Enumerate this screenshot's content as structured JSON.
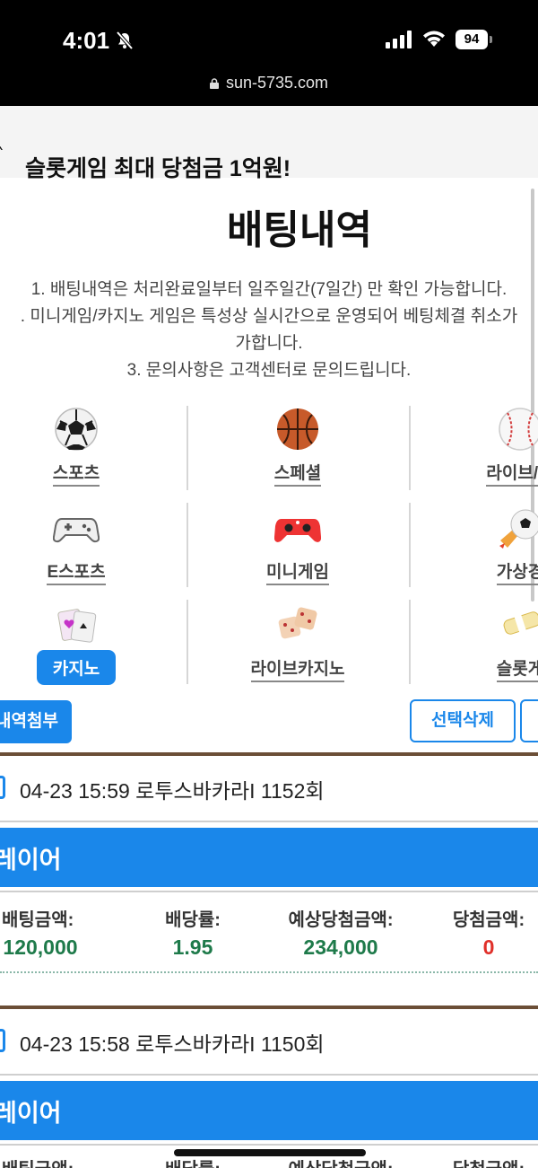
{
  "status": {
    "time": "4:01",
    "battery": "94",
    "url": "sun-5735.com"
  },
  "banner": {
    "text": "슬롯게임 최대 당첨금 1억원!"
  },
  "page": {
    "title": "배팅내역",
    "notice": [
      "1. 배팅내역은 처리완료일부터 일주일간(7일간) 만 확인 가능합니다.",
      ". 미니게임/카지노 게임은 특성상 실시간으로 운영되어 베팅체결 취소가",
      "가합니다.",
      "3. 문의사항은 고객센터로 문의드립니다."
    ]
  },
  "categories": [
    {
      "label": "스포츠",
      "icon": "soccer-ball-icon"
    },
    {
      "label": "스페셜",
      "icon": "basketball-icon"
    },
    {
      "label": "라이브/실",
      "icon": "baseball-icon"
    },
    {
      "label": "E스포츠",
      "icon": "gamepad-icon"
    },
    {
      "label": "미니게임",
      "icon": "red-controller-icon"
    },
    {
      "label": "가상경",
      "icon": "rocket-ball-icon"
    },
    {
      "label": "카지노",
      "icon": "cards-icon",
      "active": true
    },
    {
      "label": "라이브카지노",
      "icon": "dice-icon"
    },
    {
      "label": "슬롯게",
      "icon": "slot-icon"
    }
  ],
  "actions": {
    "attach": "내역첨부",
    "delete_selected": "선택삭제"
  },
  "stat_headers": [
    "배팅금액:",
    "배당률:",
    "예상당첨금액:",
    "당첨금액:"
  ],
  "bets": [
    {
      "header": "04-23 15:59  로투스바카라I 1152회",
      "result": "레이어",
      "bet_amount": "120,000",
      "odds": "1.95",
      "expected": "234,000",
      "won": "0"
    },
    {
      "header": "04-23 15:58  로투스바카라I 1150회",
      "result": "레이어"
    }
  ],
  "colors": {
    "accent": "#1a87ea",
    "value_green": "#1e7a4a",
    "value_red": "#e0302a",
    "divider_brown": "#6b4e36"
  }
}
